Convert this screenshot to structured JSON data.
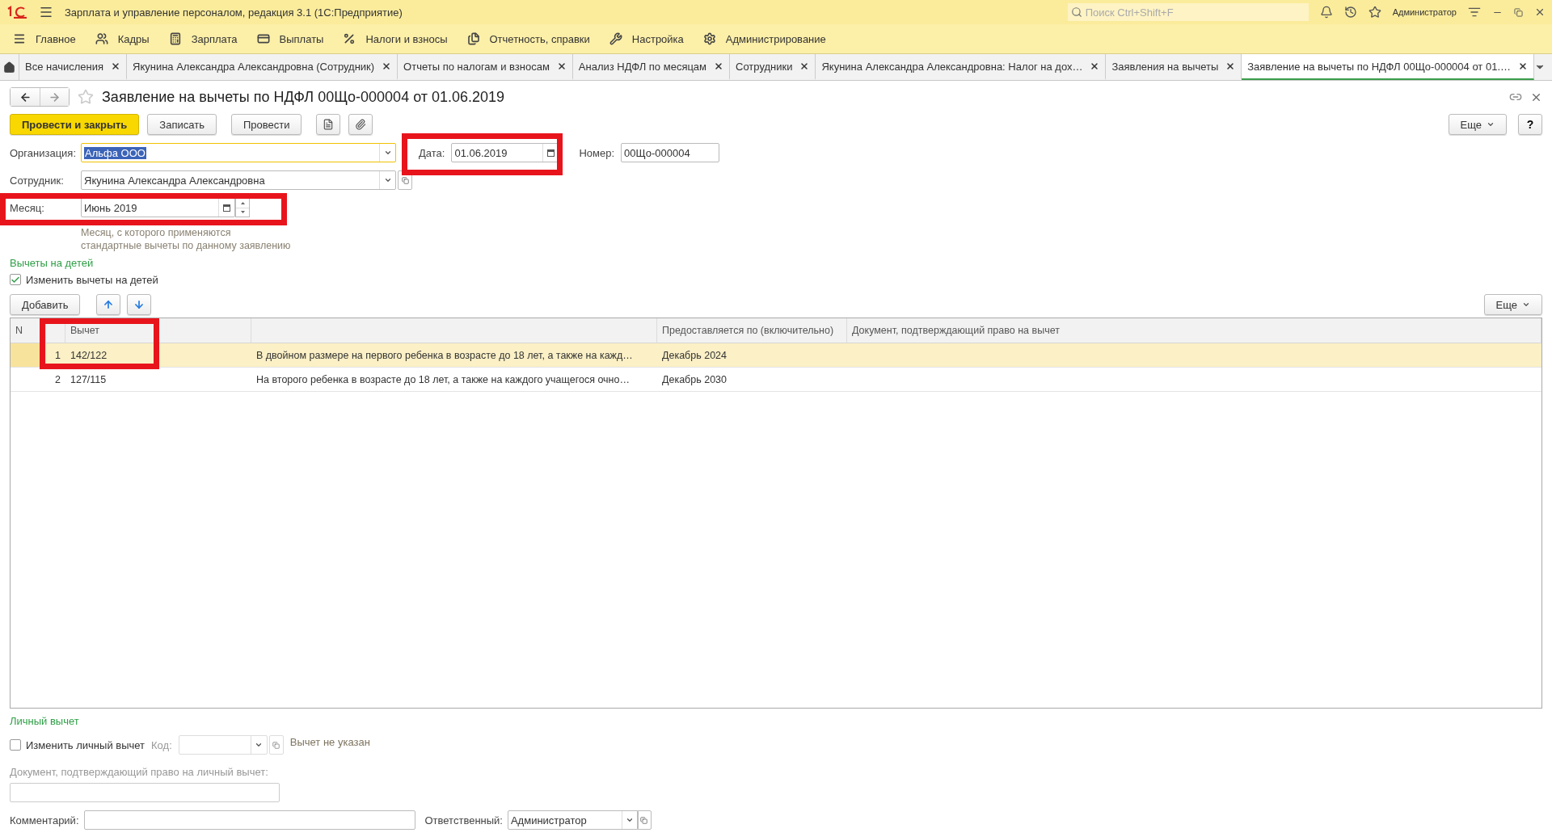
{
  "window": {
    "title": "Зарплата и управление персоналом, редакция 3.1  (1С:Предприятие)",
    "search_placeholder": "Поиск Ctrl+Shift+F",
    "user": "Администратор"
  },
  "menu": [
    {
      "label": "Главное"
    },
    {
      "label": "Кадры"
    },
    {
      "label": "Зарплата"
    },
    {
      "label": "Выплаты"
    },
    {
      "label": "Налоги и взносы"
    },
    {
      "label": "Отчетность, справки"
    },
    {
      "label": "Настройка"
    },
    {
      "label": "Администрирование"
    }
  ],
  "tabs": [
    {
      "label": "Все начисления",
      "selected": false
    },
    {
      "label": "Якунина Александра Александровна (Сотрудник)",
      "selected": false
    },
    {
      "label": "Отчеты по налогам и взносам",
      "selected": false
    },
    {
      "label": "Анализ НДФЛ по месяцам",
      "selected": false
    },
    {
      "label": "Сотрудники",
      "selected": false
    },
    {
      "label": "Якунина Александра Александровна: Налог на дох…",
      "selected": false
    },
    {
      "label": "Заявления на вычеты",
      "selected": false
    },
    {
      "label": "Заявление на вычеты по НДФЛ 00Що-000004 от 01.…",
      "selected": true
    }
  ],
  "form": {
    "title": "Заявление на вычеты по НДФЛ 00Що-000004 от 01.06.2019",
    "favorite": false,
    "buttons": [
      {
        "label": "Провести и закрыть",
        "kind": "primary"
      },
      {
        "label": "Записать",
        "kind": "normal"
      },
      {
        "label": "Провести",
        "kind": "normal"
      }
    ],
    "more": "Еще",
    "help": "?",
    "organization": {
      "label": "Организация:",
      "value": "Альфа ООО"
    },
    "date": {
      "label": "Дата:",
      "value": "01.06.2019"
    },
    "number": {
      "label": "Номер:",
      "value": "00Що-000004"
    },
    "employee": {
      "label": "Сотрудник:",
      "value": "Якунина Александра Александровна"
    },
    "month": {
      "label": "Месяц:",
      "value": "Июнь 2019"
    },
    "month_hint": [
      "Месяц, с которого применяются",
      "стандартные вычеты по данному заявлению"
    ]
  },
  "children": {
    "title": "Вычеты на детей",
    "checkbox": {
      "label": "Изменить вычеты на детей",
      "checked": true
    },
    "add": "Добавить",
    "more": "Еще",
    "table": {
      "columns": [
        "N",
        "Вычет",
        "Предоставляется по (включительно)",
        "Документ, подтверждающий право на вычет"
      ],
      "rows": [
        {
          "number": "1",
          "code": "142/122",
          "description": "В двойном размере на первого ребенка в возрасте до 18 лет, а также на кажд…",
          "until": "Декабрь 2024",
          "selected": true
        },
        {
          "number": "2",
          "code": "127/115",
          "description": "На второго ребенка в возрасте до 18 лет, а также на каждого учащегося очно…",
          "until": "Декабрь 2030",
          "selected": false
        }
      ]
    }
  },
  "personal": {
    "title": "Личный вычет",
    "checkbox": {
      "label": "Изменить личный вычет",
      "checked": false
    },
    "code_label": "Код:",
    "status": "Вычет не указан",
    "document_label": "Документ, подтверждающий право на личный вычет:"
  },
  "comment": {
    "label": "Комментарий:"
  },
  "responsible": {
    "label": "Ответственный:",
    "value": "Администратор"
  }
}
